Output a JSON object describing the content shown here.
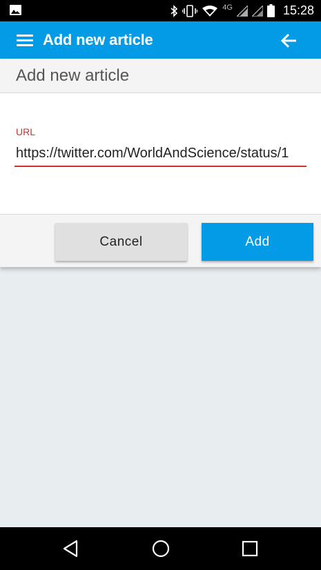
{
  "status_bar": {
    "time": "15:28",
    "network": "4G",
    "icons": [
      "gallery-icon",
      "bluetooth-icon",
      "vibrate-icon",
      "wifi-icon",
      "signal-icon",
      "battery-icon"
    ]
  },
  "app_bar": {
    "title": "Add new article",
    "background": "#039be5"
  },
  "dialog": {
    "title": "Add new article",
    "url_field": {
      "label": "URL",
      "value": "https://twitter.com/WorldAndScience/status/1",
      "error_color": "#d32f2f"
    },
    "cancel_label": "Cancel",
    "add_label": "Add"
  },
  "nav_bar": {
    "buttons": [
      "back-icon",
      "home-icon",
      "recents-icon"
    ]
  }
}
